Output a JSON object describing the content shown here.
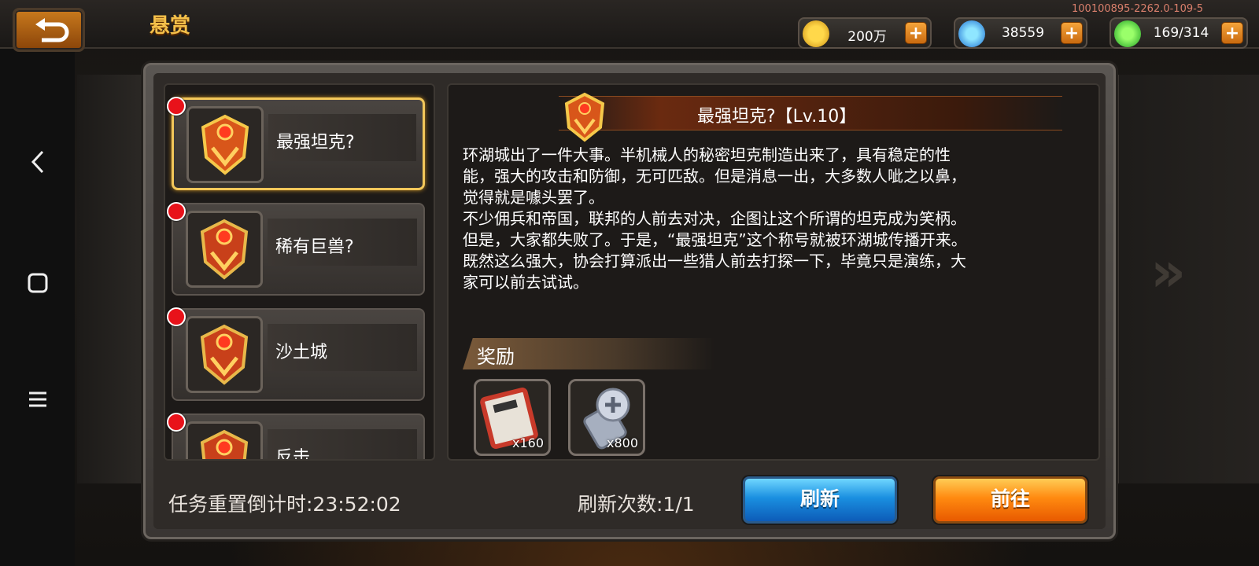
{
  "header": {
    "title": "悬赏",
    "version": "100100895-2262.0-109-5"
  },
  "resources": [
    {
      "icon": "gold-coin-icon",
      "value": "200万"
    },
    {
      "icon": "blue-gem-icon",
      "value": "38559"
    },
    {
      "icon": "green-energy-icon",
      "value": "169/314"
    }
  ],
  "quests": [
    {
      "name": "最强坦克?",
      "selected": true
    },
    {
      "name": "稀有巨兽?",
      "selected": false
    },
    {
      "name": "沙土城",
      "selected": false
    },
    {
      "name": "反击",
      "selected": false
    }
  ],
  "detail": {
    "title": "最强坦克?【Lv.10】",
    "description": [
      "环湖城出了一件大事。半机械人的秘密坦克制造出来了，具有稳定的性",
      "能，强大的攻击和防御，无可匹敌。但是消息一出，大多数人呲之以鼻，",
      "觉得就是噱头罢了。",
      "不少佣兵和帝国，联邦的人前去对决，企图让这个所谓的坦克成为笑柄。",
      "但是，大家都失败了。于是，“最强坦克”这个称号就被环湖城传播开来。",
      "既然这么强大，协会打算派出一些猎人前去打探一下，毕竟只是演练，大",
      "家可以前去试试。"
    ],
    "reward_label": "奖励",
    "rewards": [
      {
        "icon": "ticket-icon",
        "qty": "x160"
      },
      {
        "icon": "screw-bolt-icon",
        "qty": "x800"
      }
    ]
  },
  "footer": {
    "countdown": "任务重置倒计时:23:52:02",
    "refresh_count": "刷新次数:1/1",
    "refresh_button": "刷新",
    "go_button": "前往"
  },
  "colors": {
    "accent_gold": "#f4c04a",
    "selected_border": "#f2c75a",
    "notify_dot": "#e8121a",
    "refresh_blue": "#1a8fe0",
    "go_orange": "#ff8a10"
  }
}
